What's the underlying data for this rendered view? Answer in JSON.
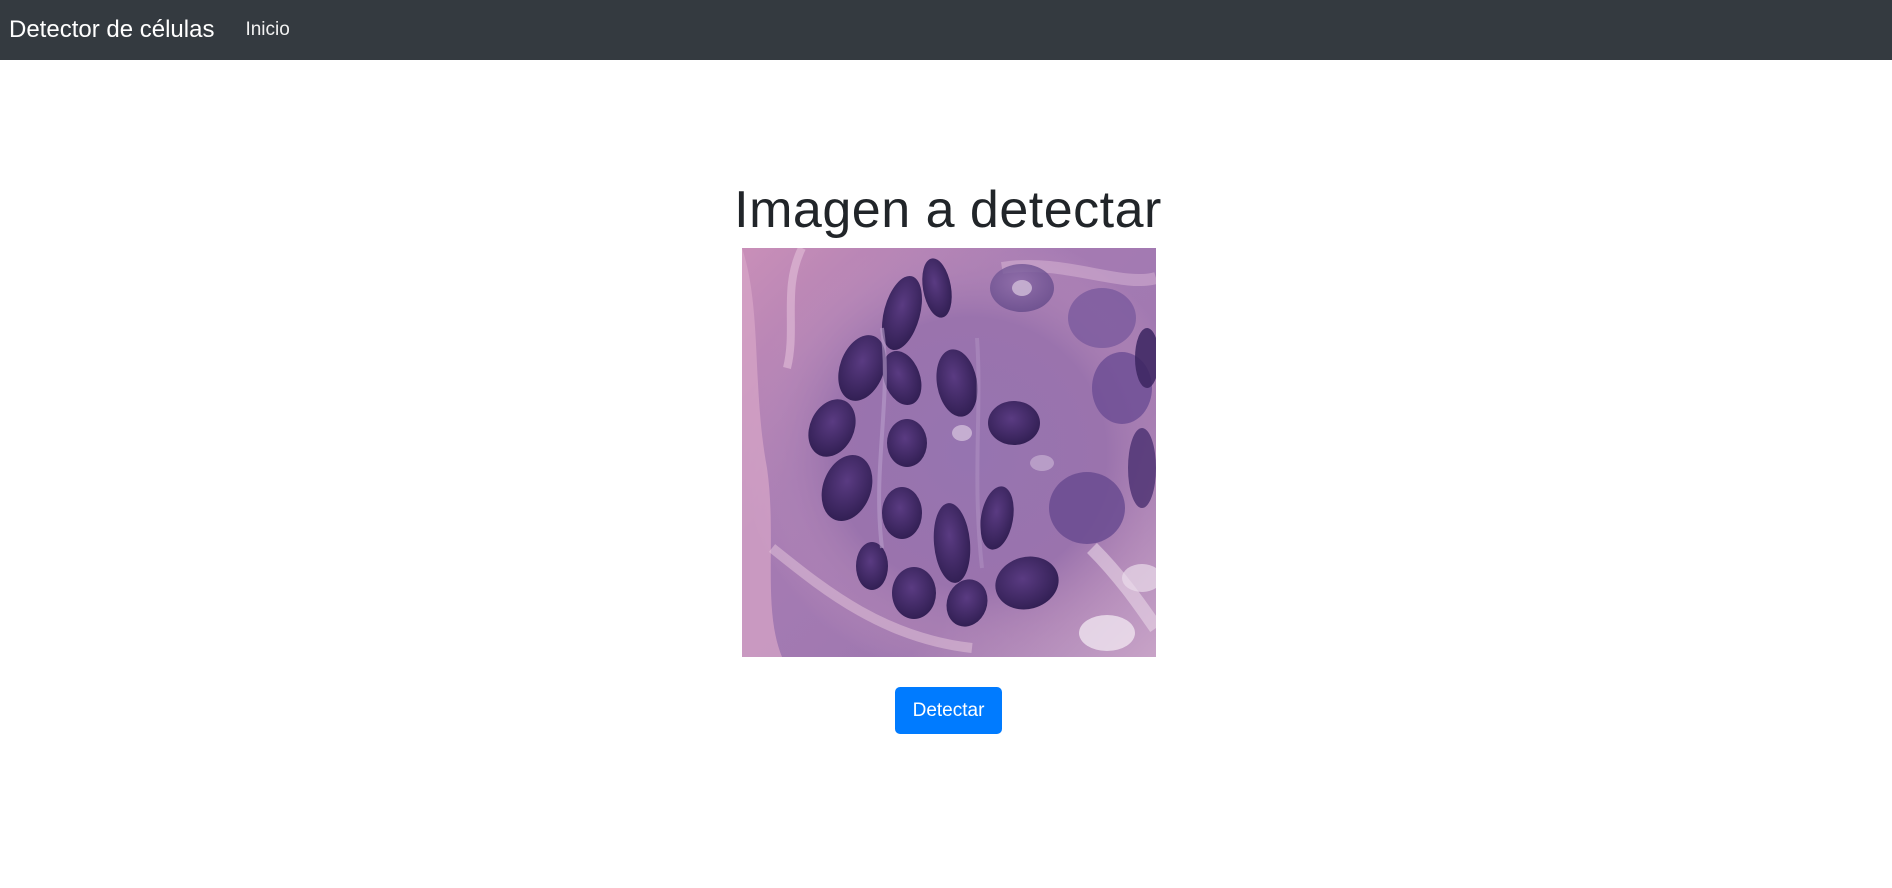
{
  "navbar": {
    "brand": "Detector de células",
    "links": [
      {
        "label": "Inicio"
      }
    ],
    "background_color": "#343a40"
  },
  "main": {
    "title": "Imagen a detectar",
    "image": {
      "icon": "histology-cell-image"
    },
    "detect_button": {
      "label": "Detectar",
      "color": "#007bff"
    }
  }
}
